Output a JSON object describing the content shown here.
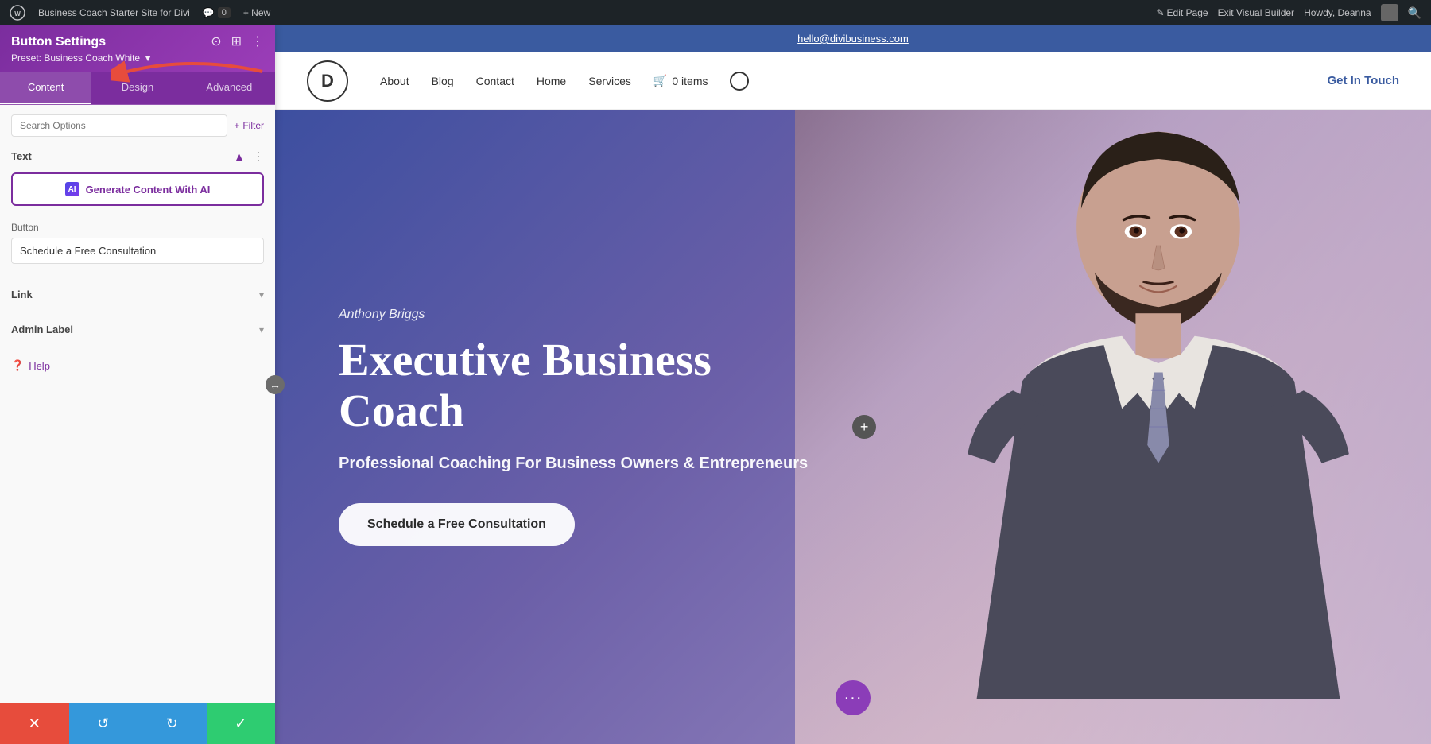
{
  "admin_bar": {
    "wp_icon": "WP",
    "site_name": "Business Coach Starter Site for Divi",
    "comments": "0",
    "new_label": "+ New",
    "pencil_icon": "✎",
    "edit_page": "Edit Page",
    "exit_visual": "Exit Visual Builder",
    "howdy": "Howdy, Deanna",
    "search_icon": "🔍"
  },
  "panel": {
    "title": "Button Settings",
    "preset_label": "Preset: Business Coach White",
    "preset_arrow": "▼",
    "icons": {
      "focus": "⊙",
      "grid": "⊞",
      "more": "⋮"
    },
    "tabs": {
      "content": "Content",
      "design": "Design",
      "advanced": "Advanced"
    },
    "search_placeholder": "Search Options",
    "filter_label": "+ Filter",
    "text_section": {
      "title": "Text",
      "toggle": "▲",
      "dots": "⋮",
      "ai_button": "Generate Content With AI",
      "ai_icon": "AI"
    },
    "button_section": {
      "label": "Button",
      "value": "Schedule a Free Consultation"
    },
    "link_section": {
      "title": "Link",
      "chevron": "▾"
    },
    "admin_label_section": {
      "title": "Admin Label",
      "chevron": "▾"
    },
    "help_label": "Help",
    "footer": {
      "close": "✕",
      "undo": "↺",
      "redo": "↻",
      "save": "✓"
    }
  },
  "site": {
    "email": "hello@divibusiness.com",
    "logo_text": "D",
    "nav": {
      "about": "About",
      "blog": "Blog",
      "contact": "Contact",
      "home": "Home",
      "services": "Services",
      "cart_icon": "🛒",
      "items_count": "0 items",
      "search_icon": "○",
      "cta": "Get In Touch"
    },
    "hero": {
      "name": "Anthony Briggs",
      "title_line1": "Executive Business",
      "title_line2": "Coach",
      "subtitle": "Professional Coaching For Business Owners & Entrepreneurs",
      "cta_button": "Schedule a Free Consultation"
    }
  }
}
